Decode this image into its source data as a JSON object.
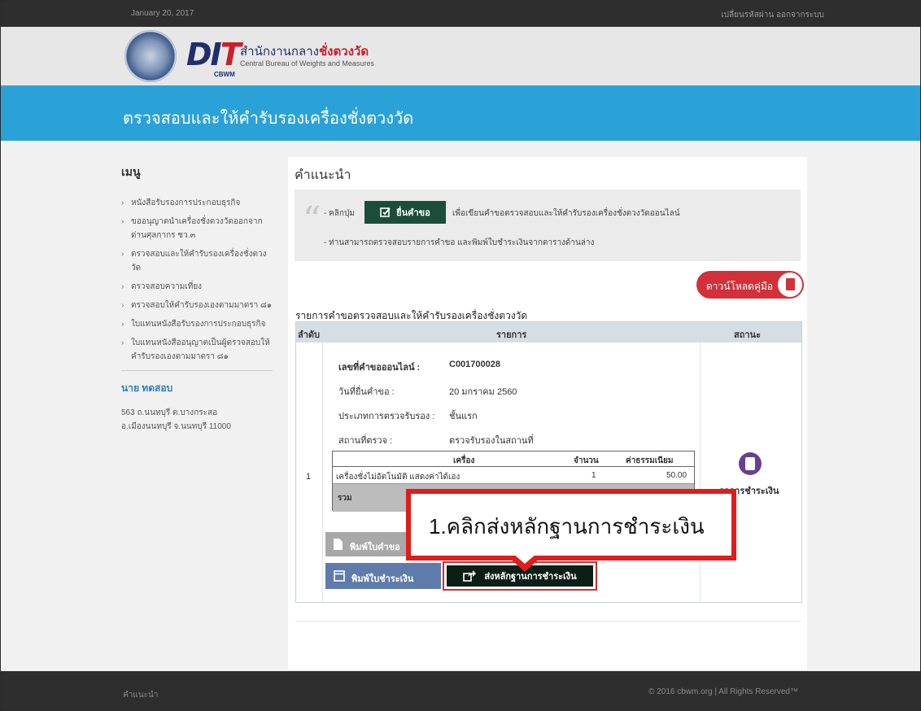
{
  "topbar": {
    "date": "January 20, 2017",
    "links": "เปลี่ยนรหัสผ่าน ออกจากระบบ"
  },
  "brand": {
    "logo_d": "D",
    "logo_i": "I",
    "logo_t": "T",
    "logo_sub": "CBWM",
    "org_th_prefix": "สำนักงานกลาง",
    "org_th_bold": "ชั่งตวงวัด",
    "org_en": "Central Bureau of Weights and Measures"
  },
  "banner": {
    "title": "ตรวจสอบและให้คำรับรองเครื่องชั่งตวงวัด"
  },
  "sidebar": {
    "heading": "เมนู",
    "items": [
      "หนังสือรับรองการประกอบธุรกิจ",
      "ขออนุญาตนำเครื่องชั่งตวงวัดออกจากด่านศุลกากร ชว.๓",
      "ตรวจสอบและให้คำรับรองเครื่องชั่งตวงวัด",
      "ตรวจสอบความเที่ยง",
      "ตรวจสอบให้คำรับรองเองตามมาตรา ๘๑",
      "ใบแทนหนังสือรับรองการประกอบธุรกิจ",
      "ใบแทนหนังสืออนุญาตเป็นผู้ตรวจสอบให้คำรับรองเองตามมาตรา ๘๑"
    ],
    "user_name": "นาย ทดสอบ",
    "address_line1": "563 ถ.นนทบุรี ต.บางกระสอ",
    "address_line2": "อ.เมืองนนทบุรี จ.นนทบุรี 11000"
  },
  "guide": {
    "title": "คำแนะนำ",
    "line1_prefix": "- คลิกปุ่ม",
    "request_button": "ยื่นคำขอ",
    "line1_suffix": "เพื่อเขียนคำขอตรวจสอบและให้คำรับรองเครื่องชั่งตวงวัดออนไลน์",
    "line2": "- ท่านสามารถตรวจสอบรายการคำขอ และพิมพ์ใบชำระเงินจากตารางด้านล่าง"
  },
  "download_button": "ดาวน์โหลดคู่มือ",
  "list": {
    "title": "รายการคำขอตรวจสอบและให้คำรับรองเครื่องชั่งตวงวัด",
    "columns": [
      "ลำดับ",
      "รายการ",
      "สถานะ"
    ]
  },
  "request": {
    "number": "1",
    "labels": [
      "เลขที่คำขอออนไลน์ :",
      "วันที่ยื่นคำขอ :",
      "ประเภทการตรวจรับรอง :",
      "สถานที่ตรวจ :"
    ],
    "values": [
      "C001700028",
      "20 มกราคม 2560",
      "ชั้นแรก",
      "ตรวจรับรองในสถานที่"
    ]
  },
  "items_table": {
    "headers": [
      "เครื่อง",
      "จำนวน",
      "ค่าธรรมเนียม"
    ],
    "rows": [
      {
        "item": "เครื่องชั่งไม่อัตโนมัติ แสดงค่าได้เอง",
        "qty": "1",
        "fee": "50.00"
      }
    ],
    "total_label": "รวม"
  },
  "actions": {
    "print_request": "พิมพ์ใบคำขอ",
    "print_payment": "พิมพ์ใบชำระเงิน",
    "send_payment": "ส่งหลักฐานการชำระเงิน"
  },
  "status": {
    "text": "รอการชำระเงิน"
  },
  "callout": {
    "text": "1.คลิกส่งหลักฐานการชำระเงิน"
  },
  "footer": {
    "left": "คำแนะนำ",
    "right": "© 2016 cbwm.org | All Rights Reserved™"
  }
}
